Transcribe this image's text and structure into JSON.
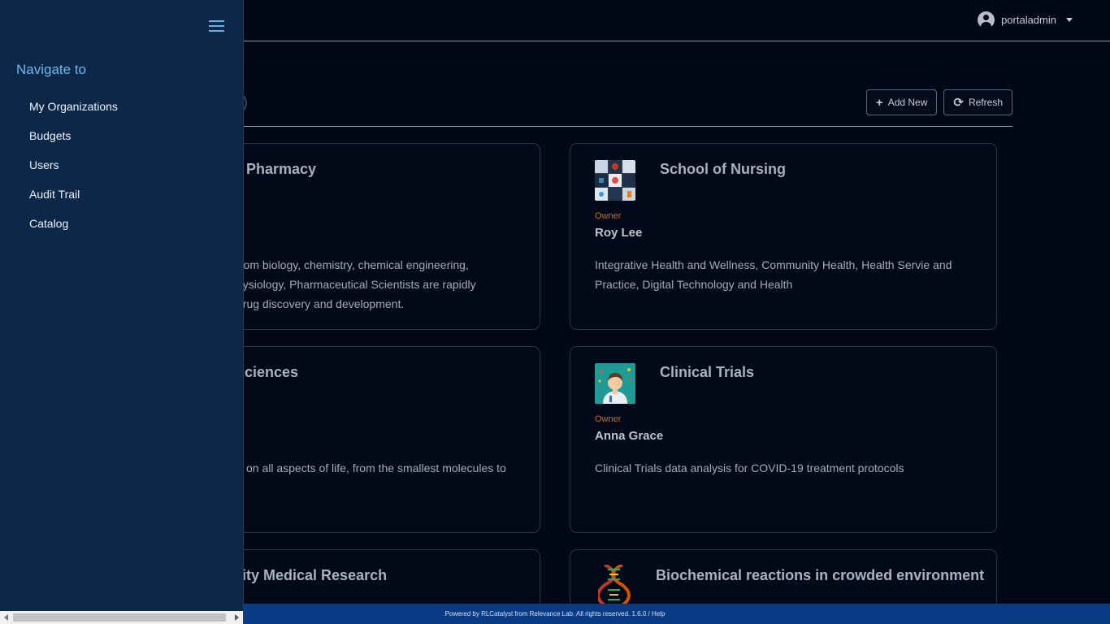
{
  "header": {
    "username": "portaladmin"
  },
  "toolbar": {
    "add_new_label": "Add New",
    "refresh_label": "Refresh"
  },
  "sidebar": {
    "heading": "Navigate to",
    "items": [
      {
        "label": "My Organizations"
      },
      {
        "label": "Budgets"
      },
      {
        "label": "Users"
      },
      {
        "label": "Audit Trail"
      },
      {
        "label": "Catalog"
      }
    ]
  },
  "projects": [
    {
      "title": "l of Pharmacy",
      "desc_lines": [
        "from biology, chemistry, chemical engineering,",
        "hysiology, Pharmaceutical Scientists are rapidly",
        "drug discovery and development."
      ]
    },
    {
      "title": "School of Nursing",
      "owner_label": "Owner",
      "owner": "Roy Lee",
      "desc_lines": [
        "Integrative Health and Wellness, Community Health, Health Servie and",
        "Practice, Digital Technology and Health"
      ]
    },
    {
      "title": "ciences",
      "desc_lines": [
        "on all aspects of life, from the smallest molecules to"
      ]
    },
    {
      "title": "Clinical Trials",
      "owner_label": "Owner",
      "owner": "Anna Grace",
      "desc_lines": [
        "Clinical Trials data analysis for COVID-19 treatment protocols"
      ]
    },
    {
      "title": "sity Medical Research"
    },
    {
      "title": "Biochemical reactions in crowded environment"
    }
  ],
  "footer": {
    "text": "Powered by RLCatalyst from Relevance Lab. All rights reserved. 1.6.0 / Help"
  },
  "colors": {
    "background": "#020817",
    "sidebar": "#0c2748",
    "footer": "#093c85",
    "owner_label": "#d46a12",
    "nav_heading": "#6cb8ea"
  },
  "icons": {
    "user": "user-circle-icon",
    "caret": "caret-down-icon",
    "add": "plus-icon",
    "refresh": "refresh-icon",
    "menu": "hamburger-menu-icon"
  }
}
